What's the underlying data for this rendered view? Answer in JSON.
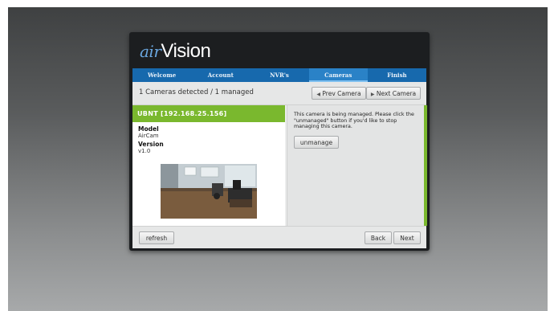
{
  "app": {
    "logo_air": "air",
    "logo_vision": "Vision"
  },
  "tabs": [
    {
      "label": "Welcome",
      "active": false
    },
    {
      "label": "Account",
      "active": false
    },
    {
      "label": "NVR's",
      "active": false
    },
    {
      "label": "Cameras",
      "active": true
    },
    {
      "label": "Finish",
      "active": false
    }
  ],
  "status": {
    "detected_text": "1 Cameras detected / 1 managed"
  },
  "nav": {
    "prev_label": "Prev Camera",
    "next_label": "Next Camera"
  },
  "camera": {
    "header": "UBNT [192.168.25.156]",
    "model_label": "Model",
    "model_value": "AirCam",
    "version_label": "Version",
    "version_value": "v1.0"
  },
  "managed": {
    "message": "This camera is being managed. Please click the \"unmanaged\" button if you'd like to stop managing this camera.",
    "unmanage_label": "unmanage"
  },
  "footer": {
    "refresh_label": "refresh",
    "back_label": "Back",
    "next_label": "Next"
  },
  "colors": {
    "accent_blue": "#1769ad",
    "accent_green": "#7ab82e"
  }
}
